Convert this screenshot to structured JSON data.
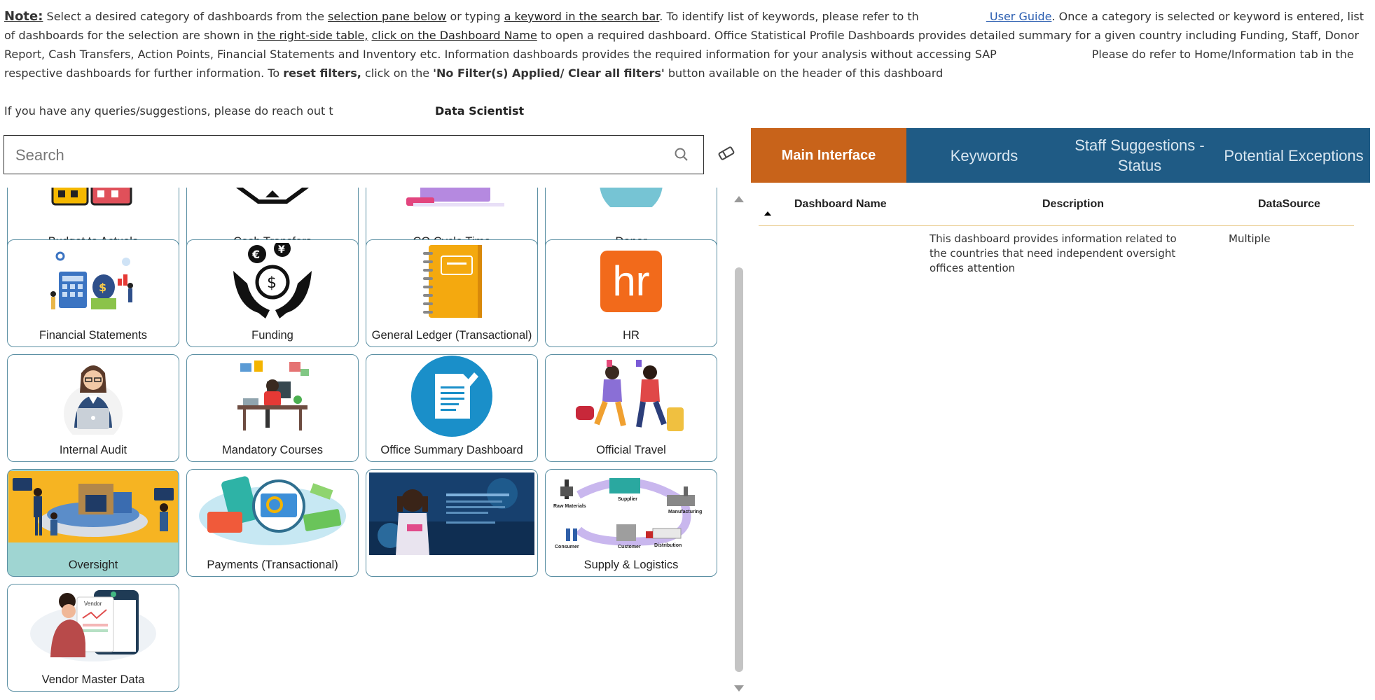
{
  "note": {
    "label": "Note:",
    "t1": " Select a desired category of dashboards from the ",
    "u1": "selection pane below",
    "t2": " or typing ",
    "u2": "a keyword in the search bar",
    "t3": ". To identify list of keywords, please refer to th",
    "link": " User Guide",
    "t4": ". Once a category is selected or keyword is entered, list of dashboards for the selection are shown in ",
    "u3": "the right-side table,",
    "t5": " ",
    "u4": "click on the Dashboard Name",
    "t6": " to open a required dashboard. Office Statistical Profile Dashboards provides detailed summary for a given country including Funding, Staff, Donor Report, Cash Transfers, Action Points, Financial Statements and Inventory etc. Information dashboards provides the required information for your analysis without accessing SAP",
    "t7": "Please do refer to Home/Information tab in the respective dashboards for further information.  To ",
    "b1": "reset filters,",
    "t8": " click on the ",
    "b2": "'No Filter(s) Applied/ Clear all filters'",
    "t9": " button available on the header of this dashboard"
  },
  "contact": {
    "text": "If you have any queries/suggestions, please do reach out t",
    "role": "Data Scientist"
  },
  "search": {
    "placeholder": "Search",
    "icon": "search-icon",
    "clear_icon": "eraser-icon"
  },
  "tiles": [
    {
      "label": "Budget to Actuals"
    },
    {
      "label": "Cash Transfers"
    },
    {
      "label": "CO Cycle Time"
    },
    {
      "label": "Donor"
    },
    {
      "label": "Financial Statements"
    },
    {
      "label": "Funding"
    },
    {
      "label": "General Ledger (Transactional)"
    },
    {
      "label": "HR",
      "logo_text": "hr"
    },
    {
      "label": "Internal Audit"
    },
    {
      "label": "Mandatory Courses"
    },
    {
      "label": "Office Summary Dashboard"
    },
    {
      "label": "Official Travel"
    },
    {
      "label": "Oversight",
      "selected": true
    },
    {
      "label": "Payments (Transactional)"
    },
    {
      "label": ""
    },
    {
      "label": "Supply & Logistics"
    },
    {
      "label": "Vendor Master Data"
    }
  ],
  "tabs": [
    {
      "label": "Main Interface",
      "active": true
    },
    {
      "label": "Keywords"
    },
    {
      "label": "Staff Suggestions - Status"
    },
    {
      "label": "Potential Exceptions"
    }
  ],
  "table": {
    "headers": [
      "Dashboard Name",
      "Description",
      "DataSource"
    ],
    "rows": [
      {
        "name": "",
        "description": "This dashboard provides information related to the countries that need independent oversight offices attention",
        "source": "Multiple"
      }
    ]
  },
  "colors": {
    "tab_active": "#c8631a",
    "tab_inactive": "#1f5b85",
    "tile_border": "#5a8fa3",
    "tile_selected": "#9fd5d2"
  }
}
